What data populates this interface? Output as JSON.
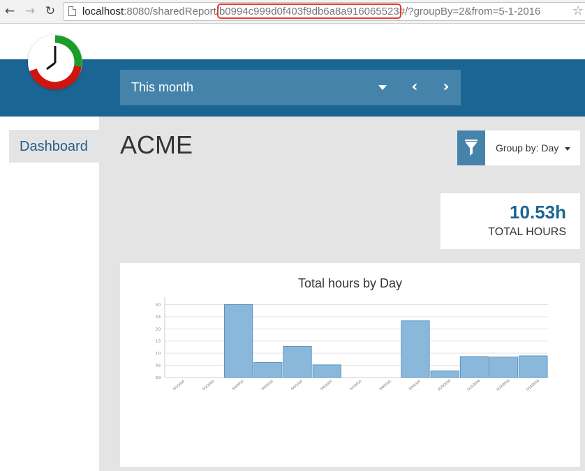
{
  "browser": {
    "url_host": "localhost",
    "url_path_prefix": ":8080/sharedReport/",
    "url_hash": "b0994c999d0f403f9db6a8a916065523",
    "url_rest": "#/?groupBy=2&from=5-1-2016"
  },
  "header": {
    "date_range_label": "This month"
  },
  "sidebar": {
    "items": [
      {
        "label": "Dashboard"
      }
    ]
  },
  "main": {
    "title": "ACME",
    "group_by_label": "Group by: Day",
    "total": {
      "value": "10.53h",
      "label": "TOTAL HOURS"
    }
  },
  "colors": {
    "header_bg": "#1b6594",
    "accent": "#4583ab",
    "bar_fill": "#8ab8db",
    "bar_stroke": "#5a93c2"
  },
  "chart_data": {
    "type": "bar",
    "title": "Total hours by Day",
    "categories": [
      "5/1/2016",
      "5/2/2016",
      "5/3/2016",
      "5/4/2016",
      "5/5/2016",
      "5/6/2016",
      "5/7/2016",
      "5/8/2016",
      "5/9/2016",
      "5/10/2016",
      "5/11/2016",
      "5/12/2016",
      "5/13/2016"
    ],
    "values": [
      0,
      0,
      3.0,
      0.62,
      1.28,
      0.52,
      0,
      0,
      2.33,
      0.27,
      0.86,
      0.84,
      0.89
    ],
    "y_ticks": [
      "0.0",
      "0.5",
      "1.0",
      "1.5",
      "2.0",
      "2.5",
      "3.0"
    ],
    "ylim": [
      0,
      3.3
    ],
    "grid": true
  }
}
